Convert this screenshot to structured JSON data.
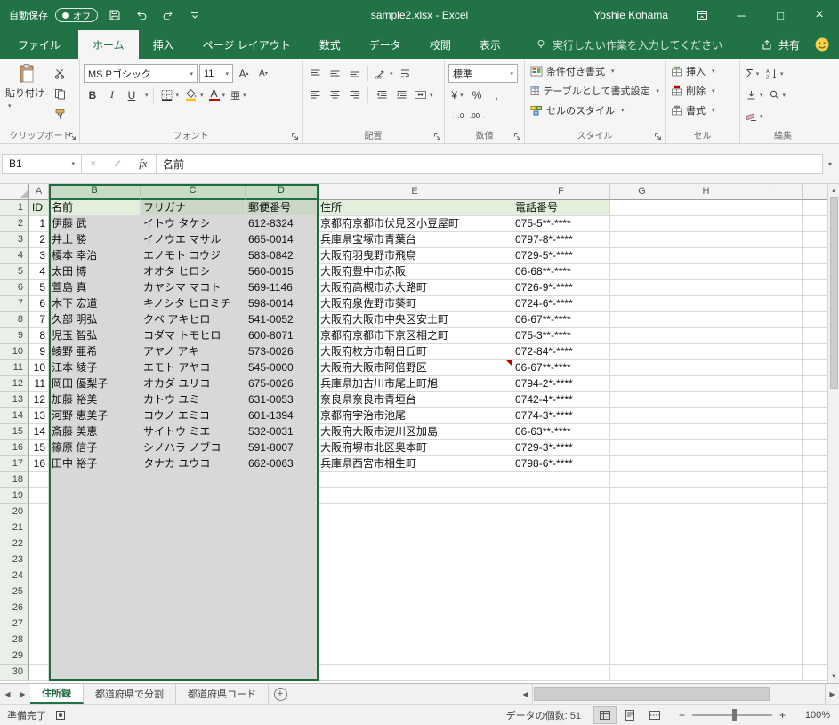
{
  "colors": {
    "excel_green": "#217346",
    "table_header_fill": "#e2efda",
    "selection_gray": "#d8d8d8",
    "selected_column_header": "#c7dbc7",
    "comment_indicator": "#c00000",
    "fill_color_swatch": "#ffc000",
    "font_color_swatch": "#c00000"
  },
  "glyphs": {
    "caret_down": "▾",
    "caret_up": "▴",
    "tri_up": "▲",
    "tri_down": "▼",
    "tri_left": "◀",
    "tri_right": "▶",
    "minimize": "─",
    "maximize": "□",
    "close": "×",
    "cancel": "×",
    "check": "✓",
    "plus": "+",
    "minus": "−"
  },
  "title_bar": {
    "autosave_label": "自動保存",
    "autosave_state": "オフ",
    "document_title": "sample2.xlsx - Excel",
    "user_name": "Yoshie Kohama"
  },
  "ribbon_tabs": {
    "file": "ファイル",
    "tabs": [
      "ホーム",
      "挿入",
      "ページ レイアウト",
      "数式",
      "データ",
      "校閲",
      "表示"
    ],
    "active_tab": "ホーム",
    "tell_me": "実行したい作業を入力してください",
    "share": "共有"
  },
  "ribbon": {
    "clipboard": {
      "group_label": "クリップボード",
      "paste_label": "貼り付け"
    },
    "font": {
      "group_label": "フォント",
      "font_name": "MS Pゴシック",
      "font_size": "11",
      "bold": "B",
      "italic": "I",
      "underline": "U",
      "grow_label": "A",
      "shrink_label": "A",
      "font_color_label": "A",
      "phonetic": "亜"
    },
    "alignment": {
      "group_label": "配置"
    },
    "number": {
      "group_label": "数値",
      "format": "標準",
      "currency": "¥",
      "percent": "%",
      "comma": ",",
      "inc_decimal": "←.0",
      "dec_decimal": ".00→"
    },
    "styles": {
      "group_label": "スタイル",
      "conditional": "条件付き書式",
      "format_as_table": "テーブルとして書式設定",
      "cell_styles": "セルのスタイル"
    },
    "cells": {
      "group_label": "セル",
      "insert": "挿入",
      "delete": "削除",
      "format": "書式"
    },
    "editing": {
      "group_label": "編集",
      "autosum": "Σ"
    }
  },
  "formula_bar": {
    "name_box": "B1",
    "fx_label": "fx",
    "value": "名前"
  },
  "sheet": {
    "column_letters": [
      "A",
      "B",
      "C",
      "D",
      "E",
      "F",
      "G",
      "H",
      "I"
    ],
    "visible_rows": 30,
    "header_row": [
      "ID",
      "名前",
      "フリガナ",
      "郵便番号",
      "住所",
      "電話番号"
    ],
    "rows": [
      [
        1,
        "伊藤 武",
        "イトウ タケシ",
        "612-8324",
        "京都府京都市伏見区小豆屋町",
        "075-5**-****"
      ],
      [
        2,
        "井上 勝",
        "イノウエ マサル",
        "665-0014",
        "兵庫県宝塚市青葉台",
        "0797-8*-****"
      ],
      [
        3,
        "榎本 幸治",
        "エノモト コウジ",
        "583-0842",
        "大阪府羽曳野市飛鳥",
        "0729-5*-****"
      ],
      [
        4,
        "太田 博",
        "オオタ ヒロシ",
        "560-0015",
        "大阪府豊中市赤阪",
        "06-68**-****"
      ],
      [
        5,
        "萱島 真",
        "カヤシマ マコト",
        "569-1146",
        "大阪府高槻市赤大路町",
        "0726-9*-****"
      ],
      [
        6,
        "木下 宏道",
        "キノシタ ヒロミチ",
        "598-0014",
        "大阪府泉佐野市葵町",
        "0724-6*-****"
      ],
      [
        7,
        "久部 明弘",
        "クベ アキヒロ",
        "541-0052",
        "大阪府大阪市中央区安土町",
        "06-67**-****"
      ],
      [
        8,
        "児玉 智弘",
        "コダマ トモヒロ",
        "600-8071",
        "京都府京都市下京区相之町",
        "075-3**-****"
      ],
      [
        9,
        "綾野 亜希",
        "アヤノ アキ",
        "573-0026",
        "大阪府枚方市朝日丘町",
        "072-84*-****"
      ],
      [
        10,
        "江本 綾子",
        "エモト アヤコ",
        "545-0000",
        "大阪府大阪市阿倍野区",
        "06-67**-****"
      ],
      [
        11,
        "岡田 優梨子",
        "オカダ ユリコ",
        "675-0026",
        "兵庫県加古川市尾上町旭",
        "0794-2*-****"
      ],
      [
        12,
        "加藤 裕美",
        "カトウ ユミ",
        "631-0053",
        "奈良県奈良市青垣台",
        "0742-4*-****"
      ],
      [
        13,
        "河野 恵美子",
        "コウノ エミコ",
        "601-1394",
        "京都府宇治市池尾",
        "0774-3*-****"
      ],
      [
        14,
        "斎藤 美恵",
        "サイトウ ミエ",
        "532-0031",
        "大阪府大阪市淀川区加島",
        "06-63**-****"
      ],
      [
        15,
        "篠原 信子",
        "シノハラ ノブコ",
        "591-8007",
        "大阪府堺市北区奥本町",
        "0729-3*-****"
      ],
      [
        16,
        "田中 裕子",
        "タナカ ユウコ",
        "662-0063",
        "兵庫県西宮市相生町",
        "0798-6*-****"
      ]
    ],
    "comment_cell": "E11",
    "selection": {
      "active_cell": "B1",
      "selected_columns": [
        "B",
        "C",
        "D"
      ]
    }
  },
  "sheet_tabs": {
    "tabs": [
      "住所録",
      "都道府県で分割",
      "都道府県コード"
    ],
    "active_tab": "住所録"
  },
  "status_bar": {
    "mode": "準備完了",
    "count_label": "データの個数: 51",
    "zoom_level": "100%"
  }
}
